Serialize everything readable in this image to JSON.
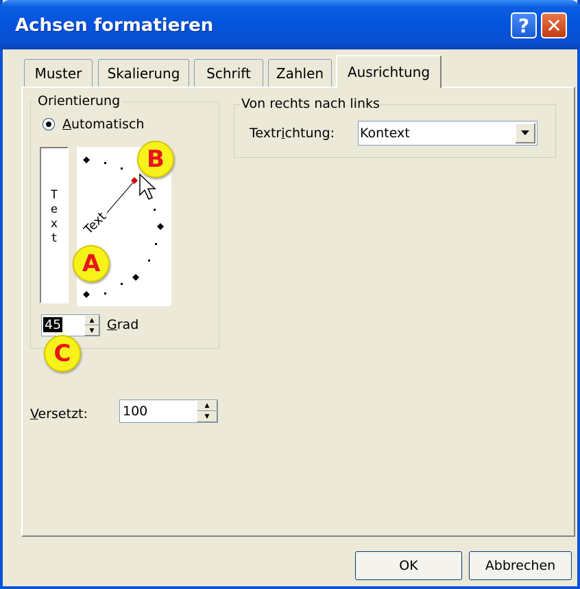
{
  "window": {
    "title": "Achsen formatieren",
    "help_glyph": "?",
    "close_glyph": "✕"
  },
  "tabs": [
    {
      "label": "Muster"
    },
    {
      "label": "Skalierung"
    },
    {
      "label": "Schrift"
    },
    {
      "label": "Zahlen"
    },
    {
      "label": "Ausrichtung"
    }
  ],
  "orientation": {
    "group_label": "Orientierung",
    "auto_radio_prefix": "A",
    "auto_radio_rest": "utomatisch",
    "vertical_text": [
      "T",
      "e",
      "x",
      "t"
    ],
    "dial_text": "Text",
    "degree_value": "45",
    "degree_label_prefix": "G",
    "degree_label_rest": "rad"
  },
  "rtl": {
    "group_label": "Von rechts nach links",
    "direction_label_a": "Textr",
    "direction_label_u": "i",
    "direction_label_b": "chtung:",
    "direction_value": "Kontext"
  },
  "offset": {
    "label_prefix": "V",
    "label_rest": "ersetzt:",
    "value": "100"
  },
  "markers": {
    "a": "A",
    "b": "B",
    "c": "C"
  },
  "buttons": {
    "ok": "OK",
    "cancel": "Abbrechen"
  }
}
